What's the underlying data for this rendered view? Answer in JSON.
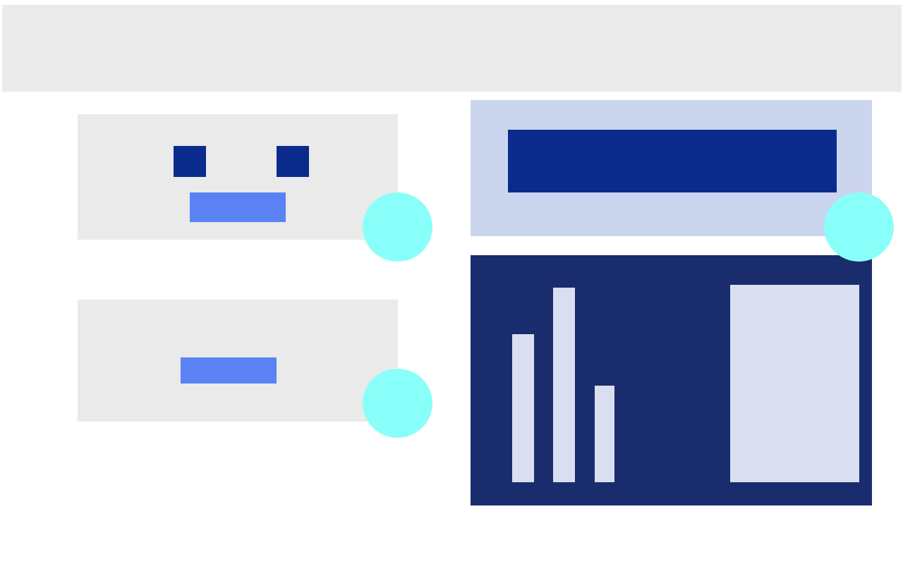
{
  "colors": {
    "background": "#ffffff",
    "light_gray": "#eaeaea",
    "dark_navy": "#0b2b8c",
    "bright_blue": "#5a82f4",
    "cyan": "#88fff8",
    "lavender": "#ccd5ee",
    "deep_navy_panel": "#192c6d",
    "pale_bar": "#d9def1"
  },
  "icons": {
    "dot_1": "circle-icon",
    "dot_2": "circle-icon",
    "dot_3": "circle-icon"
  },
  "mini_chart": {
    "relative_heights": [
      0.75,
      0.985,
      0.49
    ]
  }
}
